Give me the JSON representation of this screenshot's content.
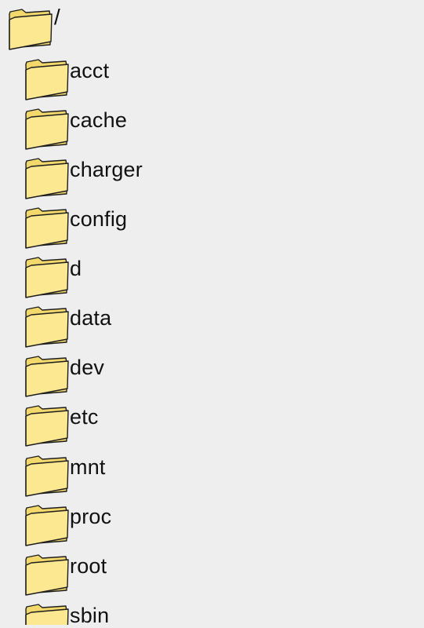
{
  "tree": {
    "root": {
      "label": "/",
      "icon": "folder-icon"
    },
    "children": [
      {
        "label": "acct",
        "icon": "folder-icon"
      },
      {
        "label": "cache",
        "icon": "folder-icon"
      },
      {
        "label": "charger",
        "icon": "folder-icon"
      },
      {
        "label": "config",
        "icon": "folder-icon"
      },
      {
        "label": "d",
        "icon": "folder-icon"
      },
      {
        "label": "data",
        "icon": "folder-icon"
      },
      {
        "label": "dev",
        "icon": "folder-icon"
      },
      {
        "label": "etc",
        "icon": "folder-icon"
      },
      {
        "label": "mnt",
        "icon": "folder-icon"
      },
      {
        "label": "proc",
        "icon": "folder-icon"
      },
      {
        "label": "root",
        "icon": "folder-icon"
      },
      {
        "label": "sbin",
        "icon": "folder-icon"
      }
    ]
  },
  "colors": {
    "background": "#eeeeee",
    "folder_fill": "#fbe891",
    "folder_back": "#f3d86c",
    "folder_stroke": "#1e1e1e",
    "text": "#111111"
  }
}
